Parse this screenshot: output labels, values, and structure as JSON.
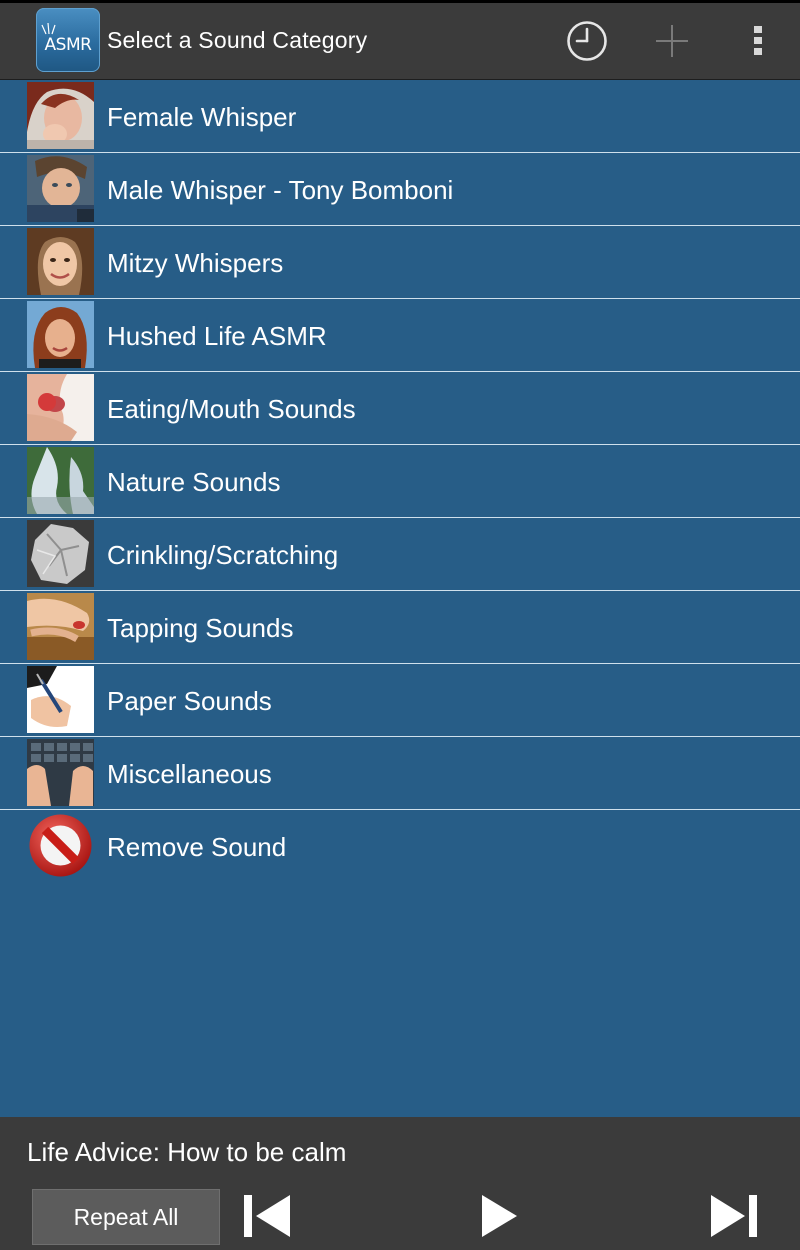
{
  "header": {
    "app_icon_text": "ASMR",
    "title": "Select a Sound Category",
    "icons": [
      "clock-icon",
      "plus-icon",
      "overflow-menu-icon"
    ]
  },
  "categories": [
    {
      "label": "Female Whisper",
      "thumbnail": "photo-female-whisper"
    },
    {
      "label": "Male Whisper - Tony Bomboni",
      "thumbnail": "photo-male-whisper"
    },
    {
      "label": "Mitzy Whispers",
      "thumbnail": "photo-mitzy"
    },
    {
      "label": "Hushed Life ASMR",
      "thumbnail": "photo-hushed-life"
    },
    {
      "label": "Eating/Mouth Sounds",
      "thumbnail": "photo-eating"
    },
    {
      "label": "Nature Sounds",
      "thumbnail": "photo-waterfall"
    },
    {
      "label": "Crinkling/Scratching",
      "thumbnail": "photo-foil"
    },
    {
      "label": "Tapping Sounds",
      "thumbnail": "photo-tapping"
    },
    {
      "label": "Paper Sounds",
      "thumbnail": "photo-writing"
    },
    {
      "label": "Miscellaneous",
      "thumbnail": "photo-keyboard"
    },
    {
      "label": "Remove Sound",
      "thumbnail": "no-entry-icon"
    }
  ],
  "player": {
    "now_playing": "Life Advice: How to be calm",
    "repeat_label": "Repeat All",
    "controls": [
      "skip-previous-icon",
      "play-icon",
      "skip-next-icon"
    ]
  },
  "colors": {
    "list_background": "#275d87",
    "action_bar": "#3b3b3b",
    "divider": "#cfe0ec",
    "text": "#ffffff"
  }
}
